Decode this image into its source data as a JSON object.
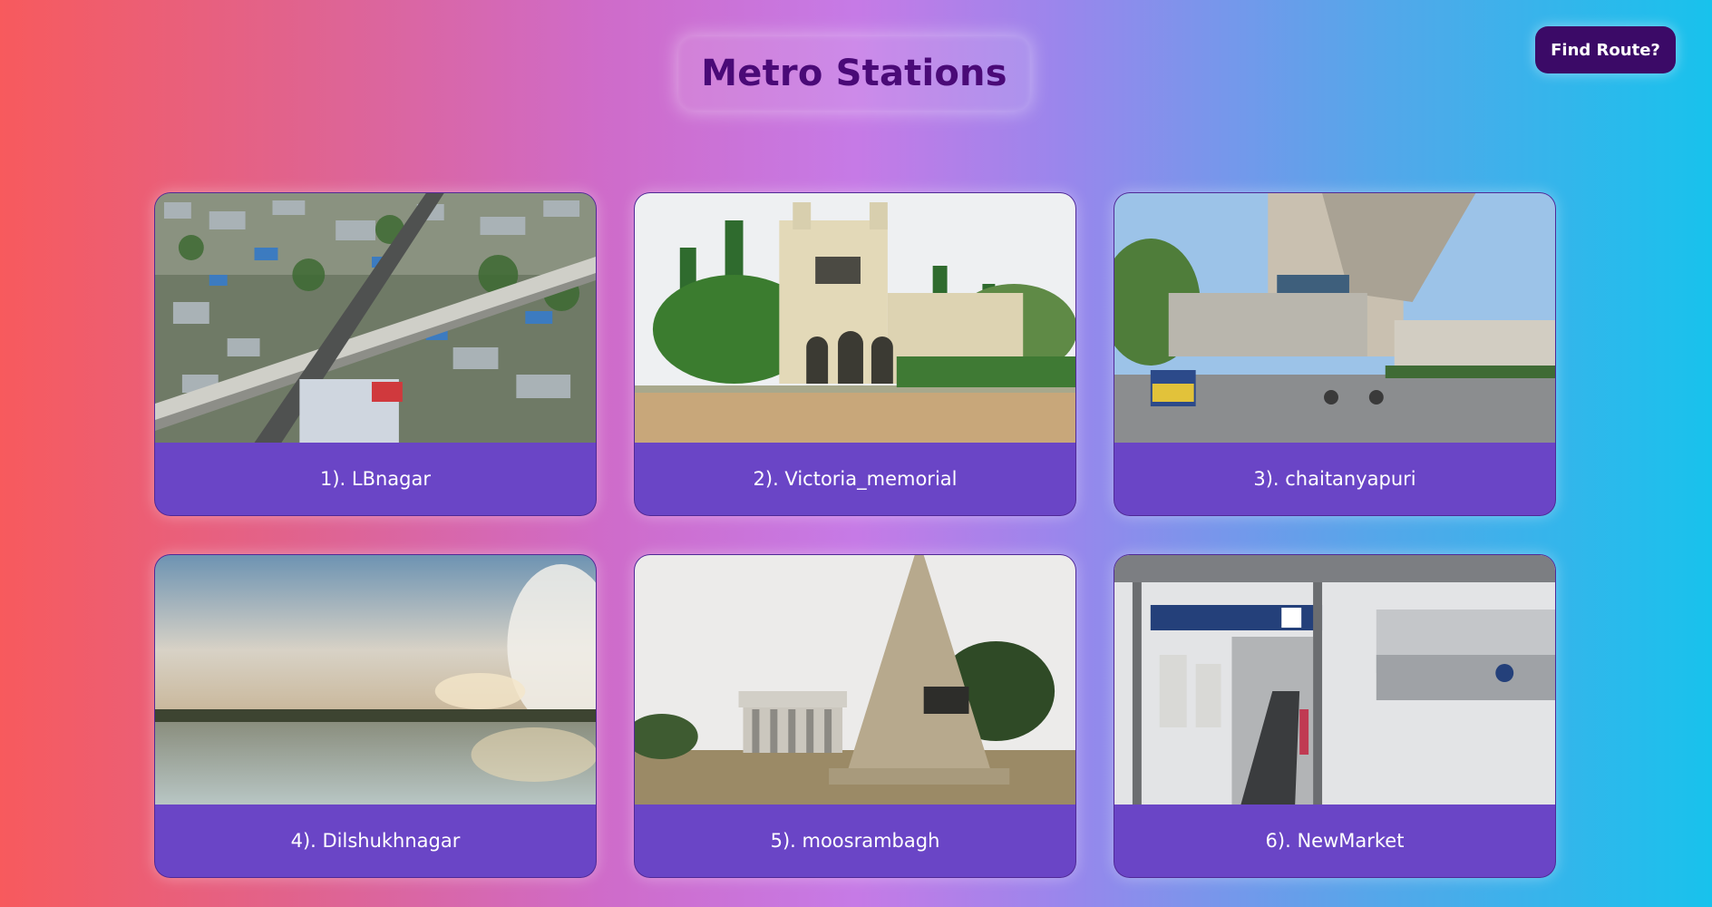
{
  "header": {
    "title": "Metro Stations",
    "find_route_label": "Find Route?"
  },
  "stations": [
    {
      "label": "1). LBnagar",
      "image": "aerial-city-flyover"
    },
    {
      "label": "2). Victoria_memorial",
      "image": "heritage-building"
    },
    {
      "label": "3). chaitanyapuri",
      "image": "metro-station-street"
    },
    {
      "label": "4). Dilshukhnagar",
      "image": "lake-sunset"
    },
    {
      "label": "5). moosrambagh",
      "image": "obelisk-monument"
    },
    {
      "label": "6). NewMarket",
      "image": "station-entrance-stairs"
    }
  ],
  "colors": {
    "title": "#4a0a77",
    "button": "#3b0a67",
    "card": "#6a45c6"
  }
}
